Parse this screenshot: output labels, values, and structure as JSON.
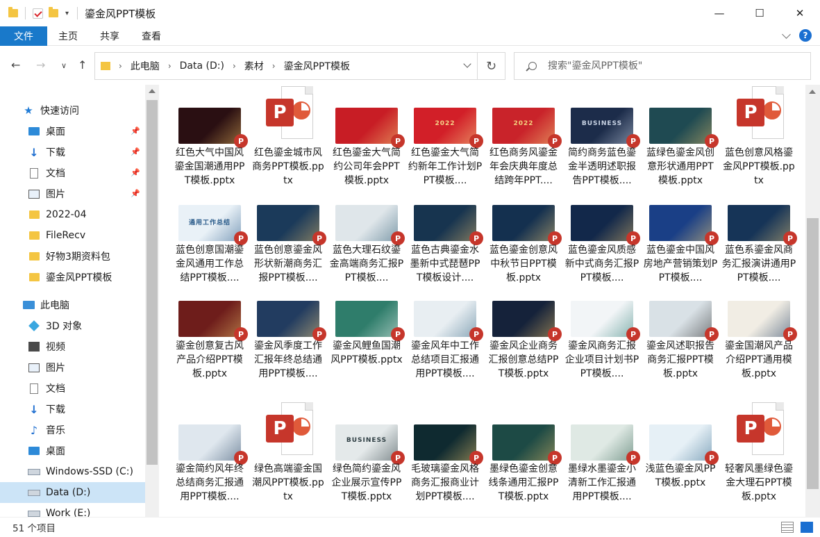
{
  "window": {
    "title": "鎏金风PPT模板",
    "minimize": "—",
    "maximize": "☐",
    "close": "✕"
  },
  "ribbon": {
    "tabs": [
      "文件",
      "主页",
      "共享",
      "查看"
    ],
    "help": "?"
  },
  "address": {
    "crumbs": [
      "此电脑",
      "Data (D:)",
      "素材",
      "鎏金风PPT模板"
    ]
  },
  "search": {
    "placeholder": "搜索\"鎏金风PPT模板\""
  },
  "sidebar": {
    "items": [
      {
        "label": "快速访问",
        "icon": "star-icon",
        "pinned": false,
        "selected": false
      },
      {
        "label": "桌面",
        "icon": "desktop-icon",
        "pinned": true,
        "selected": false
      },
      {
        "label": "下载",
        "icon": "download-icon",
        "pinned": true,
        "selected": false
      },
      {
        "label": "文档",
        "icon": "document-icon",
        "pinned": true,
        "selected": false
      },
      {
        "label": "图片",
        "icon": "pictures-icon",
        "pinned": true,
        "selected": false
      },
      {
        "label": "2022-04",
        "icon": "folder-icon",
        "pinned": false,
        "selected": false
      },
      {
        "label": "FileRecv",
        "icon": "folder-icon",
        "pinned": false,
        "selected": false
      },
      {
        "label": "好物3期资料包",
        "icon": "folder-icon",
        "pinned": false,
        "selected": false
      },
      {
        "label": "鎏金风PPT模板",
        "icon": "folder-icon",
        "pinned": false,
        "selected": false
      },
      {
        "label": "此电脑",
        "icon": "computer-icon",
        "pinned": false,
        "selected": false
      },
      {
        "label": "3D 对象",
        "icon": "3d-objects-icon",
        "pinned": false,
        "selected": false
      },
      {
        "label": "视频",
        "icon": "video-icon",
        "pinned": false,
        "selected": false
      },
      {
        "label": "图片",
        "icon": "pictures-icon",
        "pinned": false,
        "selected": false
      },
      {
        "label": "文档",
        "icon": "document-icon",
        "pinned": false,
        "selected": false
      },
      {
        "label": "下载",
        "icon": "download-icon",
        "pinned": false,
        "selected": false
      },
      {
        "label": "音乐",
        "icon": "music-icon",
        "pinned": false,
        "selected": false
      },
      {
        "label": "桌面",
        "icon": "desktop-icon",
        "pinned": false,
        "selected": false
      },
      {
        "label": "Windows-SSD (C:)",
        "icon": "drive-icon",
        "pinned": false,
        "selected": false
      },
      {
        "label": "Data (D:)",
        "icon": "drive-icon",
        "pinned": false,
        "selected": true
      },
      {
        "label": "Work (E:)",
        "icon": "drive-icon",
        "pinned": false,
        "selected": false
      }
    ]
  },
  "files": [
    {
      "label": "红色大气中国风鎏金国潮通用PPT模板.pptx",
      "thumb": "preview",
      "bg": "#2a0f12",
      "accent": "#e3b35b",
      "text": ""
    },
    {
      "label": "红色鎏金城市风商务PPT模板.pptx",
      "thumb": "ppt-icon",
      "bg": "",
      "accent": "",
      "text": ""
    },
    {
      "label": "红色鎏金大气简约公司年会PPT模板.pptx",
      "thumb": "preview",
      "bg": "#c81d25",
      "accent": "#f2cf7a",
      "text": ""
    },
    {
      "label": "红色鎏金大气简约新年工作计划PPT模板....",
      "thumb": "preview",
      "bg": "#d21f28",
      "accent": "#f5d58a",
      "text": "2022"
    },
    {
      "label": "红色商务风鎏金年会庆典年度总结跨年PPT....",
      "thumb": "preview",
      "bg": "#c9232a",
      "accent": "#f3d27d",
      "text": "2022"
    },
    {
      "label": "简约商务蓝色鎏金半透明述职报告PPT模板....",
      "thumb": "preview",
      "bg": "#1c2c4a",
      "accent": "#c9d4e5",
      "text": "BUSINESS"
    },
    {
      "label": "蓝绿色鎏金风创意形状通用PPT模板.pptx",
      "thumb": "preview",
      "bg": "#1f4a52",
      "accent": "#d8b86a",
      "text": ""
    },
    {
      "label": "蓝色创意风格鎏金风PPT模板.pptx",
      "thumb": "ppt-icon",
      "bg": "",
      "accent": "",
      "text": ""
    },
    {
      "label": "蓝色创意国潮鎏金风通用工作总结PPT模板....",
      "thumb": "preview",
      "bg": "#e9f1f7",
      "accent": "#2a5b8a",
      "text": "通用工作总结"
    },
    {
      "label": "蓝色创意鎏金风形状新潮商务汇报PPT模板....",
      "thumb": "preview",
      "bg": "#1b3a5a",
      "accent": "#d6b46a",
      "text": ""
    },
    {
      "label": "蓝色大理石纹鎏金高端商务汇报PPT模板....",
      "thumb": "preview",
      "bg": "#dfe6ea",
      "accent": "#2f5d75",
      "text": ""
    },
    {
      "label": "蓝色古典鎏金水墨新中式琵琶PPT模板设计....",
      "thumb": "preview",
      "bg": "#17344f",
      "accent": "#d8b46e",
      "text": ""
    },
    {
      "label": "蓝色鎏金创意风中秋节日PPT模板.pptx",
      "thumb": "preview",
      "bg": "#14304f",
      "accent": "#e8c677",
      "text": ""
    },
    {
      "label": "蓝色鎏金风质感新中式商务汇报PPT模板....",
      "thumb": "preview",
      "bg": "#12284a",
      "accent": "#d9b66c",
      "text": ""
    },
    {
      "label": "蓝色鎏金中国风房地产营销策划PPT模板....",
      "thumb": "preview",
      "bg": "#1a3f86",
      "accent": "#f0cf79",
      "text": ""
    },
    {
      "label": "蓝色系鎏金风商务汇报演讲通用PPT模板....",
      "thumb": "preview",
      "bg": "#163457",
      "accent": "#d8bc78",
      "text": ""
    },
    {
      "label": "鎏金创意复古风产品介绍PPT模板.pptx",
      "thumb": "preview",
      "bg": "#6e1d1b",
      "accent": "#e3b964",
      "text": ""
    },
    {
      "label": "鎏金风季度工作汇报年终总结通用PPT模板....",
      "thumb": "preview",
      "bg": "#223c60",
      "accent": "#e5c77e",
      "text": ""
    },
    {
      "label": "鎏金风鲤鱼国潮风PPT模板.pptx",
      "thumb": "preview",
      "bg": "#2f7d6b",
      "accent": "#eaf3ee",
      "text": ""
    },
    {
      "label": "鎏金风年中工作总结项目汇报通用PPT模板....",
      "thumb": "preview",
      "bg": "#e8eef2",
      "accent": "#3c6c88",
      "text": ""
    },
    {
      "label": "鎏金风企业商务汇报创意总结PPT模板.pptx",
      "thumb": "preview",
      "bg": "#15223a",
      "accent": "#dcb663",
      "text": ""
    },
    {
      "label": "鎏金风商务汇报企业项目计划书PPT模板....",
      "thumb": "preview",
      "bg": "#f2f5f7",
      "accent": "#2b7c74",
      "text": ""
    },
    {
      "label": "鎏金风述职报告商务汇报PPT模板.pptx",
      "thumb": "preview",
      "bg": "#d9e1e6",
      "accent": "#2b2b2b",
      "text": ""
    },
    {
      "label": "鎏金国潮风产品介绍PPT通用模板.pptx",
      "thumb": "preview",
      "bg": "#f1ede4",
      "accent": "#1d3a5f",
      "text": ""
    },
    {
      "label": "鎏金简约风年终总结商务汇报通用PPT模板....",
      "thumb": "preview",
      "bg": "#dfe7ee",
      "accent": "#2b4766",
      "text": ""
    },
    {
      "label": "绿色高端鎏金国潮风PPT模板.pptx",
      "thumb": "ppt-icon",
      "bg": "",
      "accent": "",
      "text": ""
    },
    {
      "label": "绿色简约鎏金风企业展示宣传PPT模板.pptx",
      "thumb": "preview",
      "bg": "#e4e9ea",
      "accent": "#2d3d42",
      "text": "BUSINESS"
    },
    {
      "label": "毛玻璃鎏金风格商务汇报商业计划PPT模板....",
      "thumb": "preview",
      "bg": "#0f2a30",
      "accent": "#e0bd6b",
      "text": ""
    },
    {
      "label": "墨绿色鎏金创意线条通用汇报PPT模板.pptx",
      "thumb": "preview",
      "bg": "#1d4a45",
      "accent": "#d6b466",
      "text": ""
    },
    {
      "label": "墨绿水墨鎏金小清新工作汇报通用PPT模板....",
      "thumb": "preview",
      "bg": "#dfe9e4",
      "accent": "#2f5f4e",
      "text": ""
    },
    {
      "label": "浅蓝色鎏金风PPT模板.pptx",
      "thumb": "preview",
      "bg": "#e6f0f6",
      "accent": "#3a6f92",
      "text": ""
    },
    {
      "label": "轻奢风墨绿色鎏金大理石PPT模板.pptx",
      "thumb": "ppt-icon",
      "bg": "",
      "accent": "",
      "text": ""
    }
  ],
  "status": {
    "count": "51 个项目"
  }
}
